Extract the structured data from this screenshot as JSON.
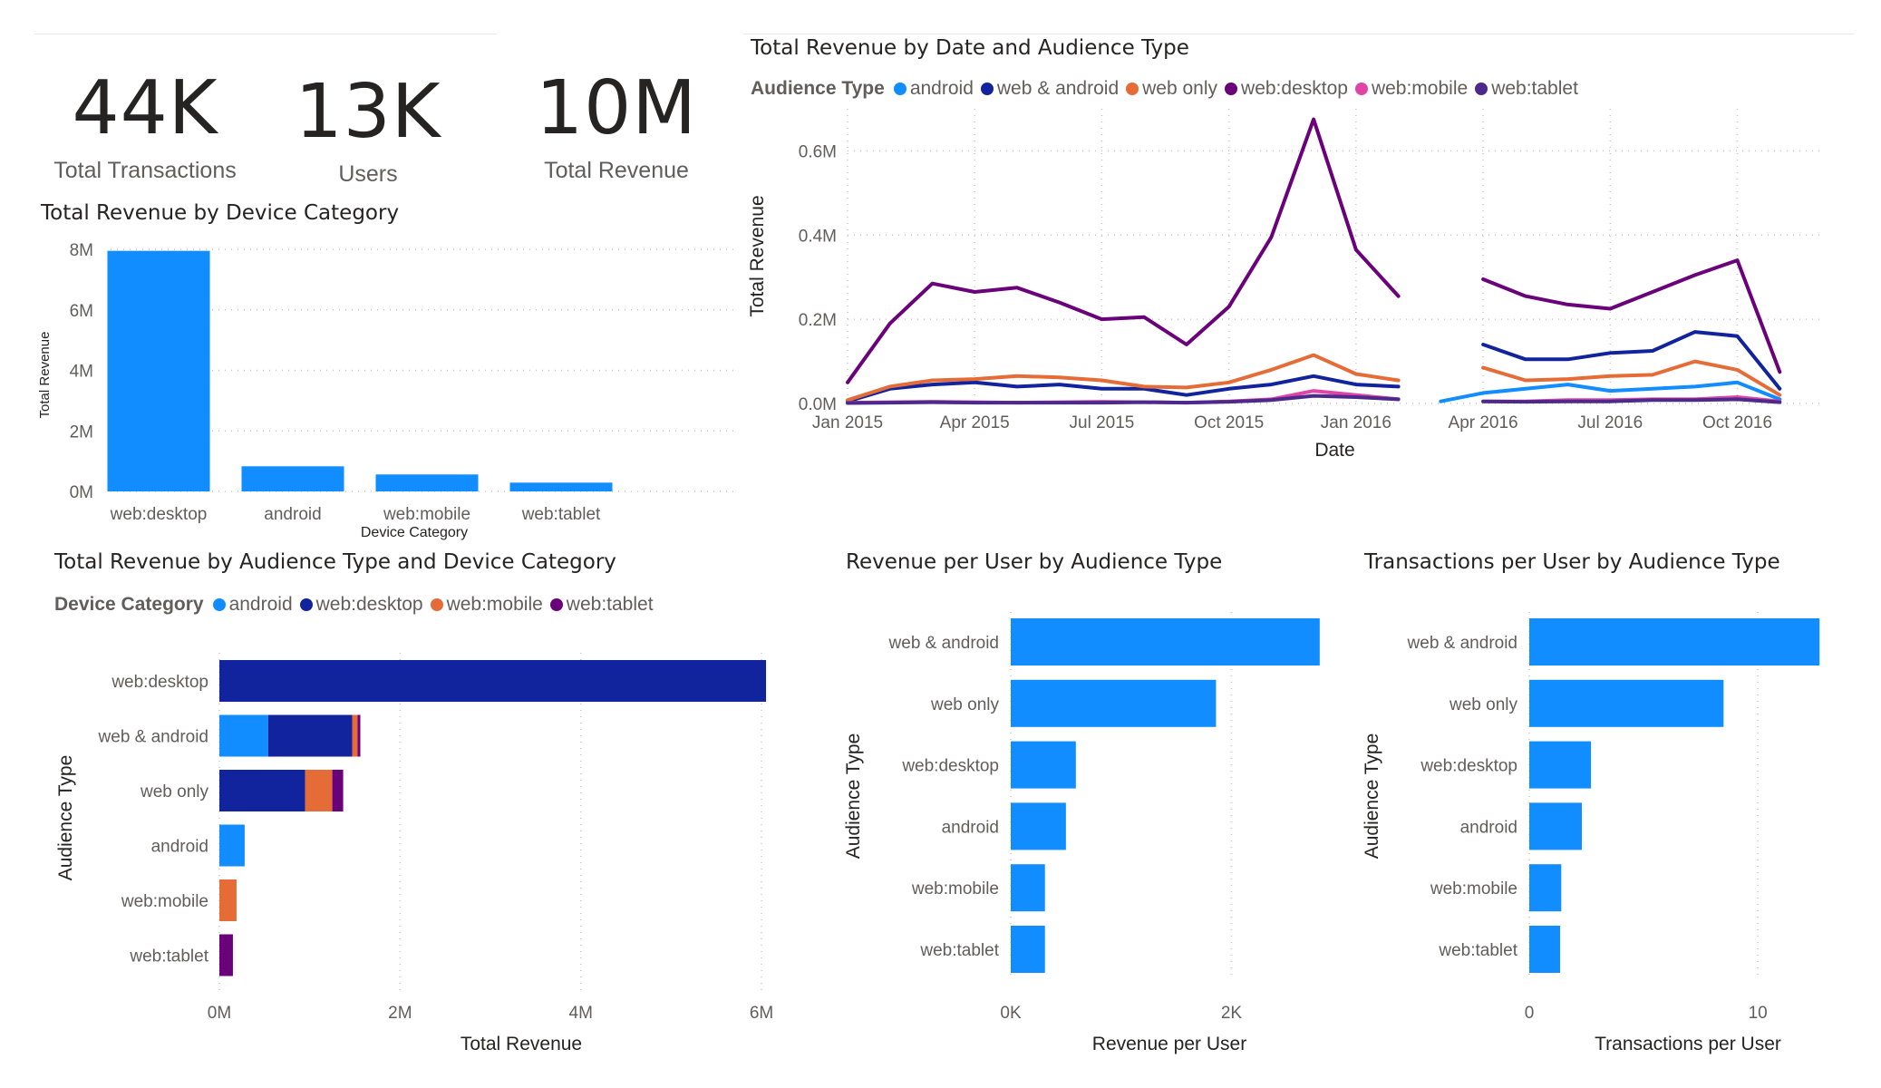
{
  "kpis": [
    {
      "value": "44K",
      "label": "Total Transactions"
    },
    {
      "value": "13K",
      "label": "Users"
    },
    {
      "value": "10M",
      "label": "Total Revenue"
    }
  ],
  "colors": {
    "android": "#118DFF",
    "web_android": "#12239E",
    "web_only": "#E66C37",
    "web_desktop": "#6B007B",
    "web_mobile": "#E044A7",
    "web_tablet": "#4B2A8C",
    "bar": "#118DFF",
    "grid": "#c8c6c4",
    "axis_text": "#605e5c",
    "title": "#252423"
  },
  "chart_data": [
    {
      "id": "line",
      "type": "line",
      "title": "Total Revenue by Date and Audience Type",
      "xlabel": "Date",
      "ylabel": "Total Revenue",
      "legend_title": "Audience Type",
      "legend_position": "top-left",
      "grid": true,
      "ylim": [
        0,
        700000
      ],
      "yticks": [
        0,
        200000,
        400000,
        600000
      ],
      "ytick_labels": [
        "0.0M",
        "0.2M",
        "0.4M",
        "0.6M"
      ],
      "xticks": [
        "2015-01",
        "2015-04",
        "2015-07",
        "2015-10",
        "2016-01",
        "2016-04",
        "2016-07",
        "2016-10"
      ],
      "xtick_labels": [
        "Jan 2015",
        "Apr 2015",
        "Jul 2015",
        "Oct 2015",
        "Jan 2016",
        "Apr 2016",
        "Jul 2016",
        "Oct 2016"
      ],
      "x": [
        "2015-01",
        "2015-02",
        "2015-03",
        "2015-04",
        "2015-05",
        "2015-06",
        "2015-07",
        "2015-08",
        "2015-09",
        "2015-10",
        "2015-11",
        "2015-12",
        "2016-01",
        "2016-02",
        "2016-03",
        "2016-04",
        "2016-05",
        "2016-06",
        "2016-07",
        "2016-08",
        "2016-09",
        "2016-10",
        "2016-11",
        "2016-12"
      ],
      "series": [
        {
          "name": "android",
          "color_key": "android",
          "values": [
            null,
            null,
            null,
            null,
            null,
            null,
            null,
            null,
            null,
            null,
            null,
            null,
            null,
            null,
            5000,
            25000,
            35000,
            45000,
            30000,
            35000,
            40000,
            50000,
            10000,
            null
          ]
        },
        {
          "name": "web & android",
          "color_key": "web_android",
          "values": [
            5000,
            35000,
            45000,
            50000,
            40000,
            45000,
            35000,
            35000,
            20000,
            35000,
            45000,
            65000,
            45000,
            40000,
            null,
            140000,
            105000,
            105000,
            120000,
            125000,
            170000,
            160000,
            35000,
            null
          ]
        },
        {
          "name": "web only",
          "color_key": "web_only",
          "values": [
            8000,
            40000,
            55000,
            58000,
            65000,
            62000,
            55000,
            40000,
            38000,
            50000,
            80000,
            115000,
            70000,
            55000,
            null,
            85000,
            55000,
            58000,
            65000,
            68000,
            100000,
            80000,
            20000,
            null
          ]
        },
        {
          "name": "web:desktop",
          "color_key": "web_desktop",
          "values": [
            50000,
            190000,
            285000,
            265000,
            275000,
            240000,
            200000,
            205000,
            140000,
            230000,
            395000,
            675000,
            365000,
            255000,
            null,
            295000,
            255000,
            235000,
            225000,
            265000,
            305000,
            340000,
            75000,
            null
          ]
        },
        {
          "name": "web:mobile",
          "color_key": "web_mobile",
          "values": [
            2000,
            3000,
            4000,
            3000,
            2000,
            3000,
            4000,
            3000,
            2000,
            5000,
            10000,
            30000,
            20000,
            10000,
            null,
            5000,
            5000,
            8000,
            8000,
            10000,
            10000,
            15000,
            5000,
            null
          ]
        },
        {
          "name": "web:tablet",
          "color_key": "web_tablet",
          "values": [
            1000,
            2000,
            3000,
            2000,
            2000,
            2000,
            2000,
            3000,
            2000,
            4000,
            8000,
            18000,
            15000,
            10000,
            null,
            5000,
            4000,
            5000,
            5000,
            8000,
            8000,
            10000,
            3000,
            null
          ]
        }
      ]
    },
    {
      "id": "device",
      "type": "bar",
      "title": "Total Revenue by Device Category",
      "xlabel": "Device Category",
      "ylabel": "Total Revenue",
      "grid": true,
      "ylim": [
        0,
        8000000
      ],
      "yticks": [
        0,
        2000000,
        4000000,
        6000000,
        8000000
      ],
      "ytick_labels": [
        "0M",
        "2M",
        "4M",
        "6M",
        "8M"
      ],
      "categories": [
        "web:desktop",
        "android",
        "web:mobile",
        "web:tablet"
      ],
      "values": [
        7950000,
        830000,
        560000,
        290000
      ]
    },
    {
      "id": "stacked",
      "type": "bar",
      "orientation": "horizontal",
      "stacked": true,
      "title": "Total Revenue by Audience Type and Device Category",
      "xlabel": "Total Revenue",
      "ylabel": "Audience Type",
      "legend_title": "Device Category",
      "legend_position": "top-left",
      "grid": true,
      "xlim": [
        0,
        6200000
      ],
      "xticks": [
        0,
        2000000,
        4000000,
        6000000
      ],
      "xtick_labels": [
        "0M",
        "2M",
        "4M",
        "6M"
      ],
      "categories": [
        "web:desktop",
        "web & android",
        "web only",
        "android",
        "web:mobile",
        "web:tablet"
      ],
      "series": [
        {
          "name": "android",
          "color_key": "android",
          "values": [
            0,
            540000,
            0,
            280000,
            0,
            0
          ]
        },
        {
          "name": "web:desktop",
          "color_key": "web_android",
          "values": [
            6050000,
            930000,
            950000,
            0,
            0,
            0
          ]
        },
        {
          "name": "web:mobile",
          "color_key": "web_only",
          "values": [
            0,
            60000,
            300000,
            0,
            190000,
            0
          ]
        },
        {
          "name": "web:tablet",
          "color_key": "web_desktop",
          "values": [
            0,
            30000,
            120000,
            0,
            0,
            150000
          ]
        }
      ]
    },
    {
      "id": "rpu",
      "type": "bar",
      "orientation": "horizontal",
      "title": "Revenue per User by Audience Type",
      "xlabel": "Revenue per User",
      "ylabel": "Audience Type",
      "grid": true,
      "xlim": [
        0,
        2900
      ],
      "xticks": [
        0,
        2000
      ],
      "xtick_labels": [
        "0K",
        "2K"
      ],
      "categories": [
        "web & android",
        "web only",
        "web:desktop",
        "android",
        "web:mobile",
        "web:tablet"
      ],
      "values": [
        2800,
        1860,
        590,
        500,
        310,
        310
      ]
    },
    {
      "id": "tpu",
      "type": "bar",
      "orientation": "horizontal",
      "title": "Transactions per User by Audience Type",
      "xlabel": "Transactions per User",
      "ylabel": "Audience Type",
      "grid": true,
      "xlim": [
        0,
        14
      ],
      "xticks": [
        0,
        10
      ],
      "xtick_labels": [
        "0",
        "10"
      ],
      "categories": [
        "web & android",
        "web only",
        "web:desktop",
        "android",
        "web:mobile",
        "web:tablet"
      ],
      "values": [
        12.7,
        8.5,
        2.7,
        2.3,
        1.4,
        1.35
      ]
    }
  ]
}
